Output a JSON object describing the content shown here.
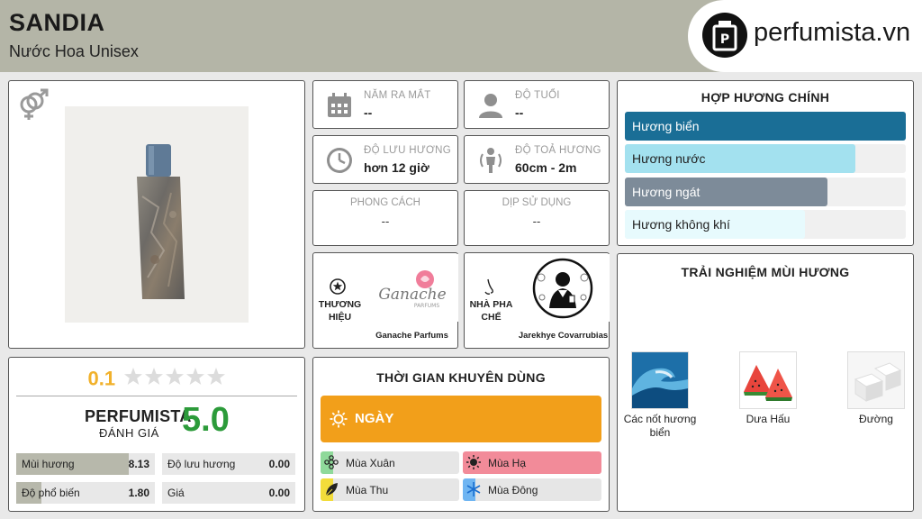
{
  "header": {
    "title": "SANDIA",
    "subtitle": "Nước Hoa Unisex",
    "logo_text": "perfumista.vn"
  },
  "product": {
    "gender_icon": "unisex-gender-icon",
    "image_alt": "perfume-bottle"
  },
  "ratings": {
    "user_score": "0.1",
    "stars_filled": 0,
    "stars_total": 5,
    "perfumista_label": "PERFUMISTA",
    "perfumista_sublabel": "ĐÁNH GIÁ",
    "perfumista_score": "5.0",
    "bars": [
      {
        "label": "Mùi hương",
        "value": "8.13",
        "fraction": 0.813
      },
      {
        "label": "Độ lưu hương",
        "value": "0.00",
        "fraction": 0.0
      },
      {
        "label": "Độ phổ biến",
        "value": "1.80",
        "fraction": 0.18
      },
      {
        "label": "Giá",
        "value": "0.00",
        "fraction": 0.0
      }
    ]
  },
  "info": {
    "release_year": {
      "label": "NĂM RA MẮT",
      "value": "--",
      "icon": "calendar-icon"
    },
    "age": {
      "label": "ĐỘ TUỔI",
      "value": "--",
      "icon": "user-icon"
    },
    "longevity": {
      "label": "ĐỘ LƯU HƯƠNG",
      "value": "hơn 12 giờ",
      "icon": "clock-icon"
    },
    "sillage": {
      "label": "ĐỘ TOẢ HƯƠNG",
      "value": "60cm - 2m",
      "icon": "sillage-person-icon"
    },
    "style": {
      "label": "PHONG CÁCH",
      "value": "--"
    },
    "occasion": {
      "label": "DỊP SỬ DỤNG",
      "value": "--"
    },
    "brand": {
      "label": "THƯƠNG HIỆU",
      "name": "Ganache Parfums",
      "logo_word": "Ganache",
      "logo_sub": "PARFUMS",
      "icon": "star-badge-icon"
    },
    "perfumer": {
      "label": "NHÀ PHA CHẾ",
      "name": "Jarekhye Covarrubias",
      "icon": "nose-icon"
    }
  },
  "recommended": {
    "title": "THỜI GIAN KHUYÊN DÙNG",
    "day_label": "NGÀY",
    "day_color": "#f29f1a",
    "seasons": [
      {
        "label": "Mùa Xuân",
        "icon": "spring-flower-icon",
        "color": "#8fd99a"
      },
      {
        "label": "Mùa Hạ",
        "icon": "summer-sun-icon",
        "color": "#f28b99"
      },
      {
        "label": "Mùa Thu",
        "icon": "autumn-leaf-icon",
        "color": "#f2dc3a"
      },
      {
        "label": "Mùa Đông",
        "icon": "winter-snowflake-icon",
        "color": "#6fb5f2"
      }
    ]
  },
  "accords": {
    "title": "HỢP HƯƠNG CHÍNH",
    "items": [
      {
        "label": "Hương biển",
        "fraction": 1.0,
        "color": "#1a6e96",
        "text_color": "#ffffff"
      },
      {
        "label": "Hương nước",
        "fraction": 0.82,
        "color": "#a3e1ef",
        "text_color": "#222222"
      },
      {
        "label": "Hương ngát",
        "fraction": 0.72,
        "color": "#7d8b99",
        "text_color": "#ffffff"
      },
      {
        "label": "Hương không khí",
        "fraction": 0.64,
        "color": "#e7fafd",
        "text_color": "#222222"
      }
    ]
  },
  "notes": {
    "title": "TRẢI NGHIỆM MÙI HƯƠNG",
    "items": [
      {
        "label": "Các nốt hương biển",
        "image": "ocean-wave-image"
      },
      {
        "label": "Dưa Hấu",
        "image": "watermelon-image"
      },
      {
        "label": "Đường",
        "image": "sugar-cubes-image"
      }
    ]
  }
}
